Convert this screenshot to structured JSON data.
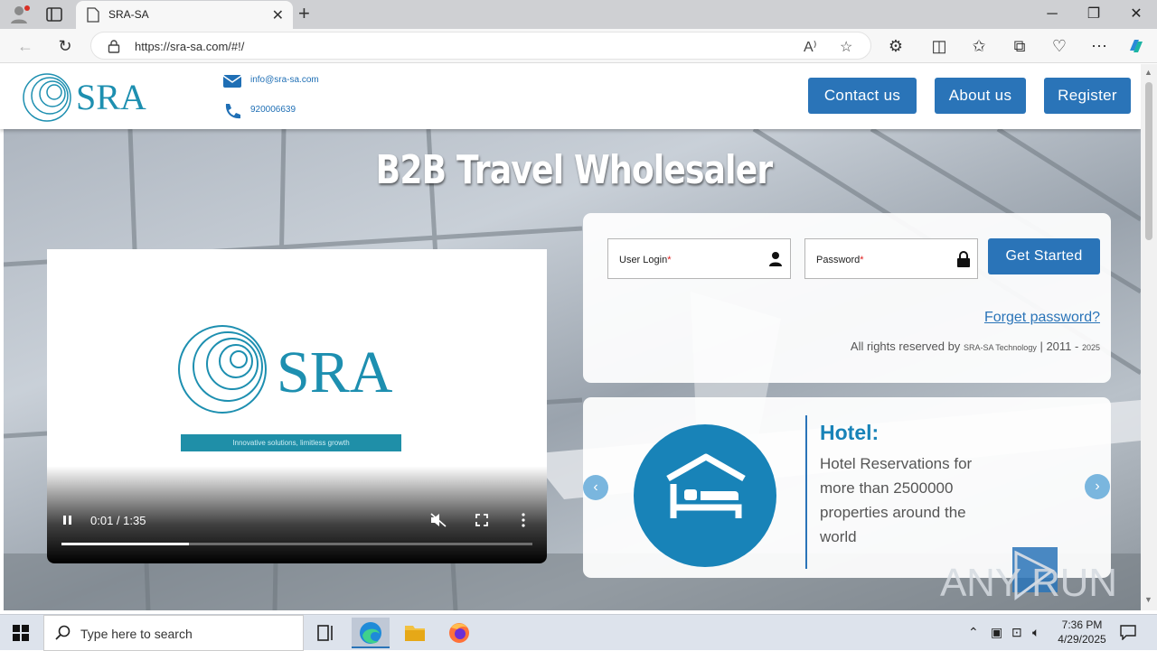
{
  "browser": {
    "tab_title": "SRA-SA",
    "url": "https://sra-sa.com/#!/"
  },
  "header": {
    "logo_text": "SRA",
    "email": "info@sra-sa.com",
    "phone": "920006639",
    "buttons": {
      "contact": "Contact us",
      "about": "About us",
      "register": "Register"
    }
  },
  "hero": {
    "title": "B2B Travel Wholesaler"
  },
  "video": {
    "logo_text": "SRA",
    "tagline": "Innovative solutions, limitless growth",
    "time": "0:01 / 1:35",
    "progress": 0.27
  },
  "login": {
    "user_label": "User Login",
    "password_label": "Password",
    "required_mark": "*",
    "submit": "Get Started",
    "forget": "Forget password?",
    "rights_prefix": "All rights reserved by",
    "rights_company": "SRA-SA Technology",
    "rights_sep": "| 2011 -",
    "rights_year": "2025"
  },
  "service": {
    "title": "Hotel:",
    "description": "Hotel Reservations for more than 2500000 properties around the world"
  },
  "watermark": "ANY RUN",
  "taskbar": {
    "search_placeholder": "Type here to search",
    "time": "7:36 PM",
    "date": "4/29/2025"
  }
}
